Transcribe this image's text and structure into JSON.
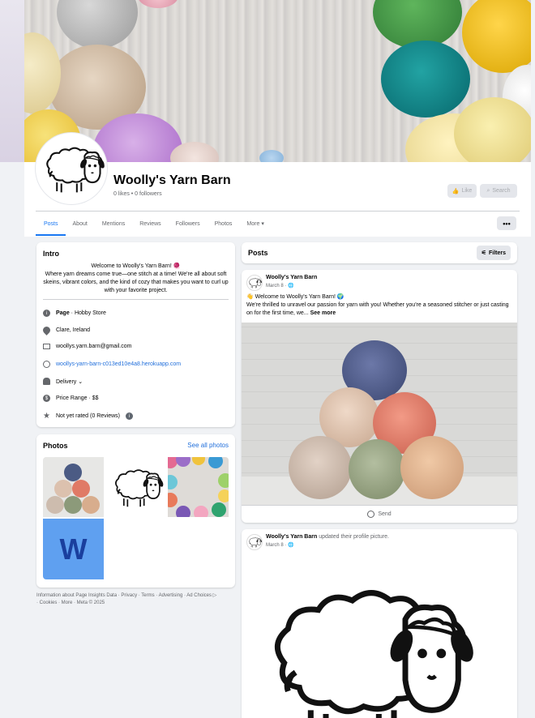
{
  "page": {
    "name": "Woolly's Yarn Barn",
    "stats": "0 likes • 0 followers",
    "like_label": "Like",
    "search_label": "Search",
    "more_dots": "•••"
  },
  "tabs": [
    {
      "label": "Posts"
    },
    {
      "label": "About"
    },
    {
      "label": "Mentions"
    },
    {
      "label": "Reviews"
    },
    {
      "label": "Followers"
    },
    {
      "label": "Photos"
    },
    {
      "label": "More ▾"
    }
  ],
  "intro": {
    "title": "Intro",
    "bio_line1": "Welcome to Woolly's Yarn Barn! 🧶",
    "bio_rest": "Where yarn dreams come true—one stitch at a time! We're all about soft skeins, vibrant colors, and the kind of cozy that makes you want to curl up with your favorite project.",
    "category_bold": "Page",
    "category_rest": " · Hobby Store",
    "location": "Clare, Ireland",
    "email": "woollys.yarn.barn@gmail.com",
    "website": "woollys-yarn-barn-c013ed10e4a8.herokuapp.com",
    "delivery": "Delivery  ⌄",
    "price_range": "Price Range · $$",
    "rating": "Not yet rated (0 Reviews)"
  },
  "photos": {
    "title": "Photos",
    "see_all": "See all photos",
    "w_letter": "W"
  },
  "footer": {
    "line1": "Information about Page Insights Data · Privacy · Terms · Advertising · Ad Choices ▷",
    "line2": "· Cookies · More · Meta © 2025"
  },
  "posts": {
    "title": "Posts",
    "filters_label": "Filters",
    "post1": {
      "author": "Woolly's Yarn Barn",
      "date": "March 8 · 🌐",
      "text_line1": "👋 Welcome to Woolly's Yarn Barn! 🌍",
      "text_rest": "We're thrilled to unravel our passion for yarn with you! Whether you're a seasoned stitcher or just casting on for the first time, we...",
      "see_more": "See more",
      "send_label": "Send"
    },
    "post2": {
      "author": "Woolly's Yarn Barn",
      "action": " updated their profile picture.",
      "date": "March 8 · 🌐"
    }
  },
  "colors": {
    "accent": "#1877f2",
    "background": "#f0f2f5",
    "w_logo_bg": "#5fa0f0",
    "w_logo_text": "#1a3f9e"
  }
}
